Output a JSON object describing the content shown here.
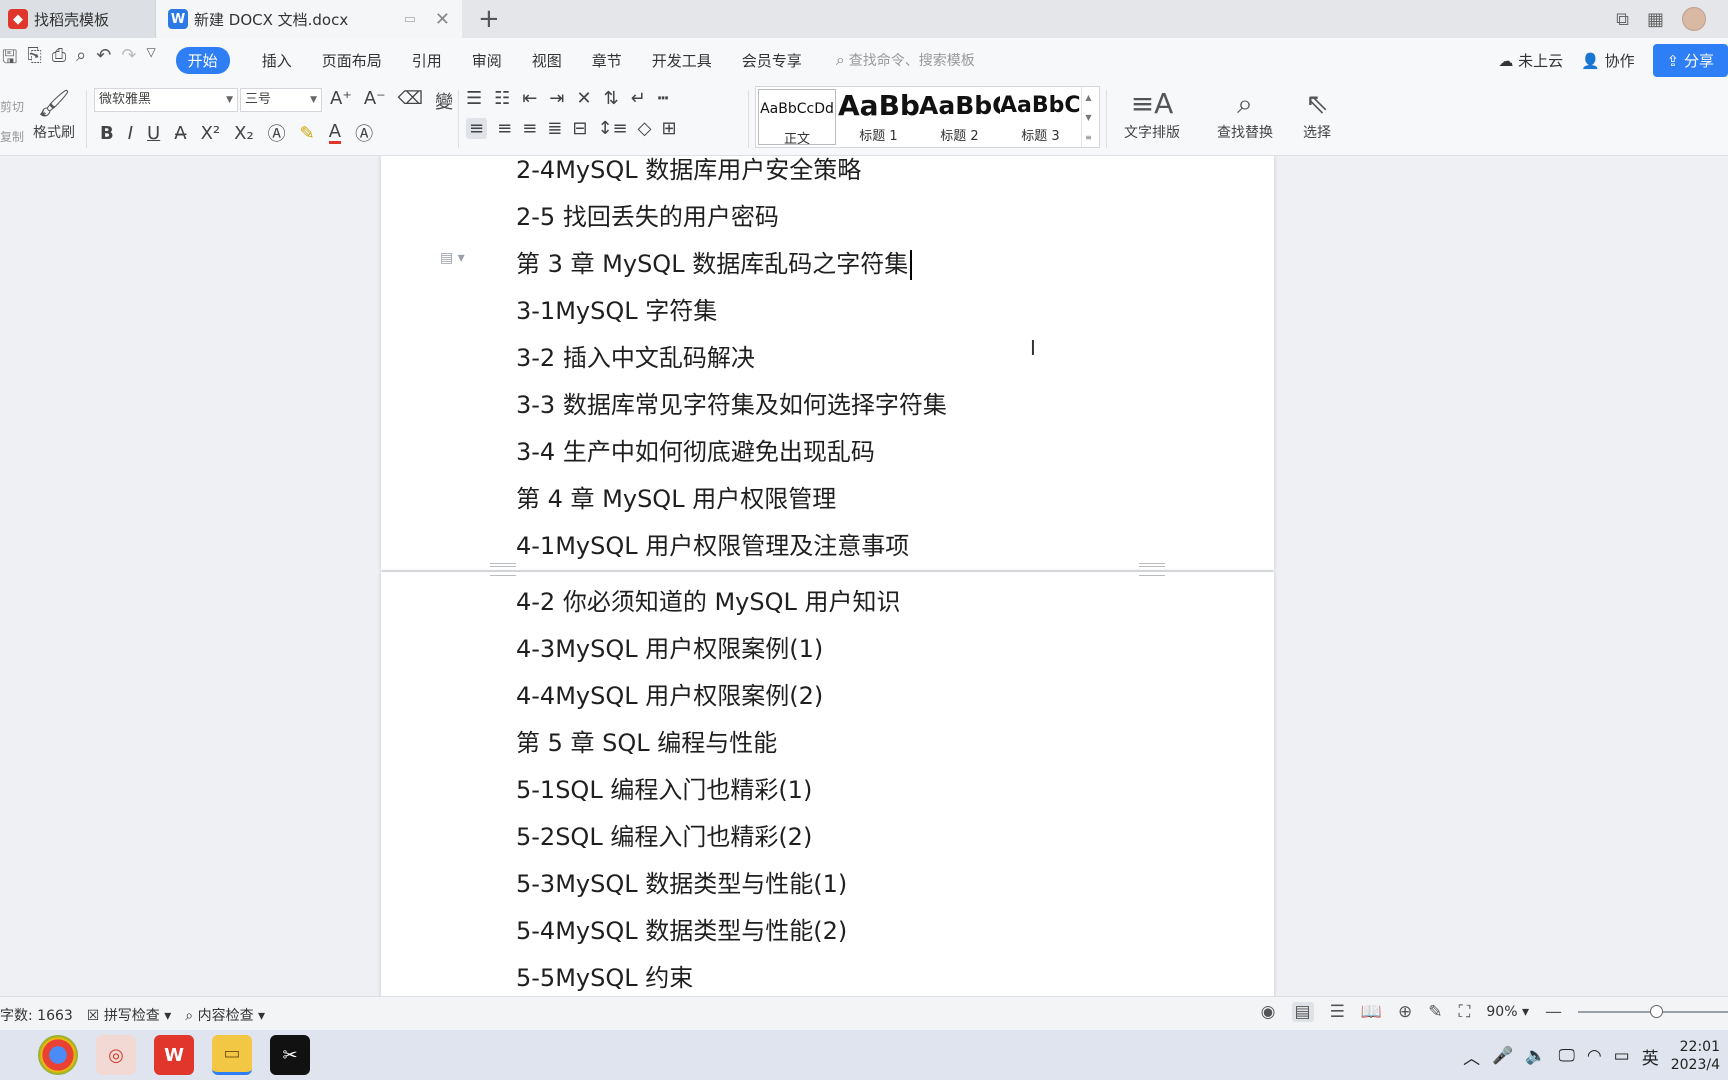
{
  "tabs": [
    {
      "label": "找稻壳模板",
      "icon": "find-template-icon"
    },
    {
      "label": "新建 DOCX 文档.docx",
      "icon": "wps-writer-icon"
    }
  ],
  "menu": {
    "items": [
      "开始",
      "插入",
      "页面布局",
      "引用",
      "审阅",
      "视图",
      "章节",
      "开发工具",
      "会员专享"
    ],
    "active": "开始",
    "search_placeholder": "查找命令、搜索模板",
    "right": {
      "cloud": "未上云",
      "collab": "协作",
      "share": "分享"
    }
  },
  "ribbon": {
    "cut": "剪切",
    "copy": "复制",
    "format_painter": "格式刷",
    "font_name": "微软雅黑",
    "font_size": "三号",
    "styles": [
      {
        "sample": "AaBbCcDd",
        "label": "正文"
      },
      {
        "sample": "AaBb",
        "label": "标题 1"
      },
      {
        "sample": "AaBbC",
        "label": "标题 2"
      },
      {
        "sample": "AaBbCc",
        "label": "标题 3"
      }
    ],
    "text_layout": "文字排版",
    "find_replace": "查找替换",
    "select": "选择"
  },
  "document": {
    "page1_lines": [
      "2-4MySQL 数据库用户安全策略",
      "2-5 找回丢失的用户密码",
      "第 3 章 MySQL 数据库乱码之字符集",
      "3-1MySQL 字符集",
      "3-2 插入中文乱码解决",
      "3-3 数据库常见字符集及如何选择字符集",
      "3-4 生产中如何彻底避免出现乱码",
      "第 4 章 MySQL 用户权限管理",
      "4-1MySQL 用户权限管理及注意事项"
    ],
    "page2_lines": [
      "4-2 你必须知道的 MySQL 用户知识",
      "4-3MySQL 用户权限案例(1)",
      "4-4MySQL 用户权限案例(2)",
      "第 5 章 SQL 编程与性能",
      "5-1SQL 编程入门也精彩(1)",
      "5-2SQL 编程入门也精彩(2)",
      "5-3MySQL 数据类型与性能(1)",
      "5-4MySQL 数据类型与性能(2)",
      "5-5MySQL 约束"
    ]
  },
  "status": {
    "word_count": "字数: 1663",
    "spell_check": "拼写检查",
    "content_check": "内容检查",
    "zoom": "90%"
  },
  "taskbar": {
    "ime": "英",
    "time": "22:01",
    "date": "2023/4"
  },
  "colors": {
    "accent": "#2e7ef5",
    "wps_red": "#e0362c"
  }
}
